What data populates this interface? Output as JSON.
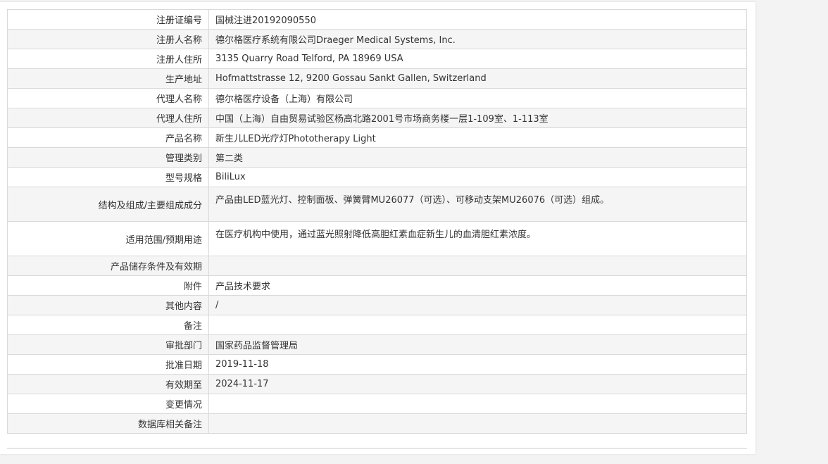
{
  "rows": [
    {
      "label": "注册证编号",
      "value": "国械注进20192090550"
    },
    {
      "label": "注册人名称",
      "value": "德尔格医疗系统有限公司Draeger Medical Systems, Inc."
    },
    {
      "label": "注册人住所",
      "value": "3135 Quarry Road Telford, PA 18969 USA"
    },
    {
      "label": "生产地址",
      "value": "Hofmattstrasse 12, 9200 Gossau Sankt Gallen, Switzerland"
    },
    {
      "label": "代理人名称",
      "value": "德尔格医疗设备（上海）有限公司"
    },
    {
      "label": "代理人住所",
      "value": "中国（上海）自由贸易试验区杨高北路2001号市场商务楼一层1-109室、1-113室"
    },
    {
      "label": "产品名称",
      "value": "新生儿LED光疗灯Phototherapy Light"
    },
    {
      "label": "管理类别",
      "value": "第二类"
    },
    {
      "label": "型号规格",
      "value": "BiliLux"
    },
    {
      "label": "结构及组成/主要组成成分",
      "value": "产品由LED蓝光灯、控制面板、弹簧臂MU26077（可选）、可移动支架MU26076（可选）组成。"
    },
    {
      "label": "适用范围/预期用途",
      "value": "在医疗机构中使用，通过蓝光照射降低高胆红素血症新生儿的血清胆红素浓度。"
    },
    {
      "label": "产品储存条件及有效期",
      "value": ""
    },
    {
      "label": "附件",
      "value": "产品技术要求"
    },
    {
      "label": "其他内容",
      "value": "/"
    },
    {
      "label": "备注",
      "value": ""
    },
    {
      "label": "审批部门",
      "value": "国家药品监督管理局"
    },
    {
      "label": "批准日期",
      "value": "2019-11-18"
    },
    {
      "label": "有效期至",
      "value": "2024-11-17"
    },
    {
      "label": "变更情况",
      "value": ""
    },
    {
      "label": "数据库相关备注",
      "value": ""
    }
  ]
}
